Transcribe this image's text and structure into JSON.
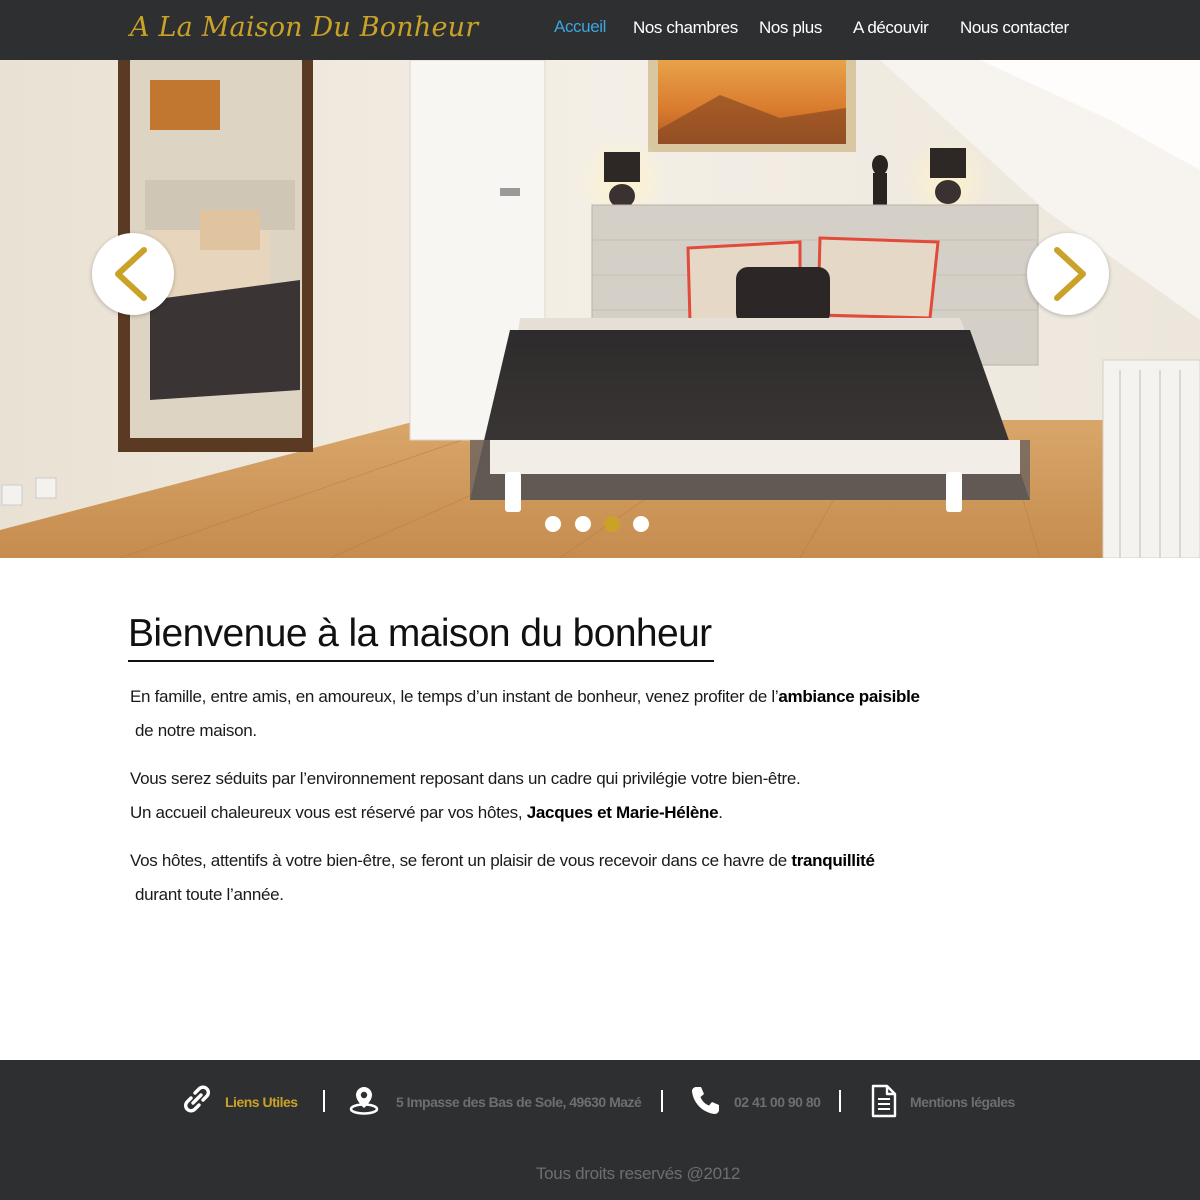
{
  "brand": {
    "name": "A La Maison Du Bonheur",
    "colors": {
      "gold": "#c9a227",
      "dark": "#2e2f31",
      "active_link": "#3ba6e0",
      "muted": "#6d6e70"
    }
  },
  "nav": {
    "items": [
      {
        "label": "Accueil",
        "active": true
      },
      {
        "label": "Nos chambres",
        "active": false
      },
      {
        "label": "Nos plus",
        "active": false
      },
      {
        "label": "A découvir",
        "active": false
      },
      {
        "label": "Nous contacter",
        "active": false
      }
    ]
  },
  "slider": {
    "prev_icon": "chevron-left-icon",
    "next_icon": "chevron-right-icon",
    "slide_count": 4,
    "active_slide": 3
  },
  "main": {
    "title": "Bienvenue à la maison du bonheur",
    "p1": {
      "text": "En famille, entre amis, en amoureux, le temps d’un instant de bonheur, venez profiter de l’",
      "bold": "ambiance paisible",
      "after": "de notre maison."
    },
    "p2": {
      "line1": "Vous serez séduits par l’environnement reposant dans un cadre qui privilégie votre bien-être.",
      "line2_text": "Un accueil chaleureux vous est réservé par vos hôtes, ",
      "line2_bold": "Jacques et Marie-Hélène",
      "line2_end": "."
    },
    "p3": {
      "text": "Vos hôtes, attentifs à votre bien-être, se feront un plaisir de vous recevoir dans ce havre de ",
      "bold": "tranquillité",
      "after": "durant toute l’année."
    }
  },
  "footer": {
    "links": {
      "icon": "link-icon",
      "label": "Liens Utiles"
    },
    "address": {
      "icon": "map-pin-icon",
      "label": "5 Impasse des Bas de Sole, 49630 Mazé"
    },
    "phone": {
      "icon": "phone-icon",
      "label": "02 41 00 90 80"
    },
    "legal": {
      "icon": "document-icon",
      "label": "Mentions légales"
    },
    "copyright": "Tous droits reservés @2012"
  }
}
